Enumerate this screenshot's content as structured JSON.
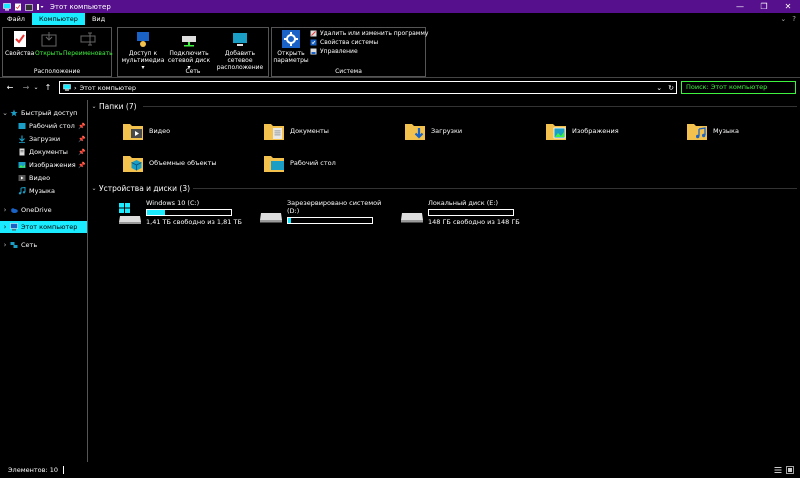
{
  "window": {
    "title": "Этот компьютер",
    "minimize": "—",
    "maximize": "❐",
    "close": "✕"
  },
  "ribbon_tabs": [
    {
      "label": "Файл",
      "active": false
    },
    {
      "label": "Компьютер",
      "active": true
    },
    {
      "label": "Вид",
      "active": false
    }
  ],
  "ribbon_tabs_right": {
    "expand": "⌄",
    "help": "?"
  },
  "ribbon": {
    "group_location": {
      "label": "Расположение",
      "properties": "Свойства",
      "open": "Открыть",
      "rename": "Переименовать"
    },
    "group_network": {
      "label": "Сеть",
      "media_access_line1": "Доступ к",
      "media_access_line2": "мультимедиа ▾",
      "map_drive_line1": "Подключить",
      "map_drive_line2": "сетевой диск ▾",
      "add_location_line1": "Добавить сетевое",
      "add_location_line2": "расположение"
    },
    "group_system": {
      "label": "Система",
      "open_settings_line1": "Открыть",
      "open_settings_line2": "параметры",
      "uninstall": "Удалить или изменить программу",
      "system_properties": "Свойства системы",
      "manage": "Управление"
    }
  },
  "addressbar": {
    "back": "←",
    "forward": "→",
    "recent": "⌄",
    "up": "↑",
    "path_sep": "›",
    "path": "Этот компьютер",
    "dropdown": "⌄",
    "refresh": "↻",
    "search_placeholder": "Поиск: Этот компьютер"
  },
  "navpane": {
    "quick_access": "Быстрый доступ",
    "pinned": [
      {
        "label": "Рабочий стол",
        "pin": "📌"
      },
      {
        "label": "Загрузки",
        "pin": "📌"
      },
      {
        "label": "Документы",
        "pin": "📌"
      },
      {
        "label": "Изображения",
        "pin": "📌"
      },
      {
        "label": "Видео",
        "pin": ""
      },
      {
        "label": "Музыка",
        "pin": ""
      }
    ],
    "onedrive": "OneDrive",
    "this_pc": "Этот компьютер",
    "network": "Сеть"
  },
  "content": {
    "folders_header": "Папки (7)",
    "folders": [
      {
        "label": "Видео"
      },
      {
        "label": "Документы"
      },
      {
        "label": "Загрузки"
      },
      {
        "label": "Изображения"
      },
      {
        "label": "Музыка"
      },
      {
        "label": "Объемные объекты"
      },
      {
        "label": "Рабочий стол"
      }
    ],
    "drives_header": "Устройства и диски (3)",
    "drives": [
      {
        "name": "Windows 10 (C:)",
        "free": "1,41 ТБ свободно из 1,81 ТБ",
        "used_fraction": 0.22
      },
      {
        "name": "Зарезервировано системой",
        "name2": "(D:)",
        "free": "",
        "used_fraction": 0.04
      },
      {
        "name": "Локальный диск (E:)",
        "free": "148 ГБ свободно из 148 ГБ",
        "used_fraction": 0.0
      }
    ]
  },
  "statusbar": {
    "items_count": "Элементов: 10"
  },
  "colors": {
    "titlebar": "#56108d",
    "accent": "#1aebff",
    "highlight_text": "#3ff23f",
    "folder": "#f2c14e"
  }
}
